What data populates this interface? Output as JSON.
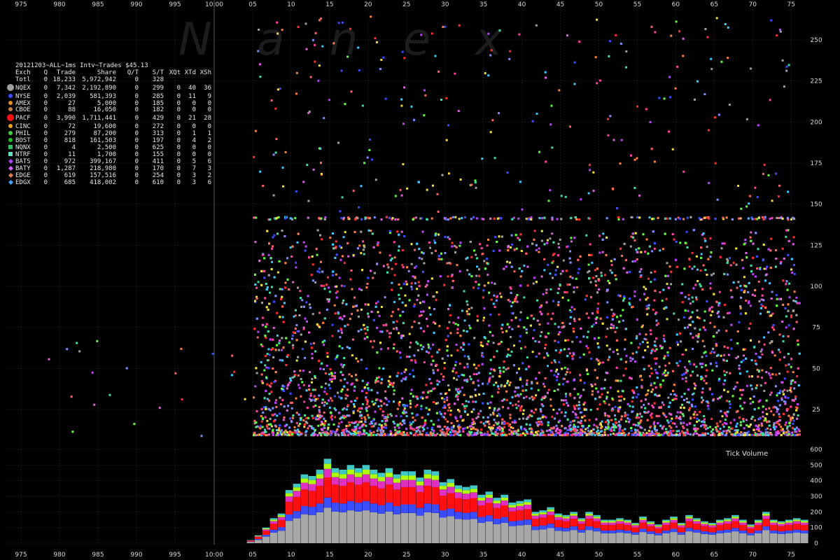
{
  "watermark": "N  a  n  e  x",
  "legend": {
    "title": "20121203~ALL~1ms Intv~Trades $45.13",
    "headers": [
      "Exch",
      "Q",
      "Trade",
      "Share",
      "Q/T",
      "S/T",
      "XQt",
      "XTd",
      "XSh"
    ],
    "rows": [
      {
        "exch": "Totl",
        "q": "0",
        "trade": "18,233",
        "share": "5,972,942",
        "qt": "0",
        "st": "328",
        "xqt": "",
        "xtd": "",
        "xsh": "",
        "color": "",
        "marker": "none"
      },
      {
        "exch": "NQEX",
        "q": "0",
        "trade": "7,342",
        "share": "2,192,890",
        "qt": "0",
        "st": "299",
        "xqt": "0",
        "xtd": "40",
        "xsh": "36",
        "color": "#a0a0a0",
        "marker": "big"
      },
      {
        "exch": "NYSE",
        "q": "0",
        "trade": "2,039",
        "share": "581,393",
        "qt": "0",
        "st": "285",
        "xqt": "0",
        "xtd": "11",
        "xsh": "9",
        "color": "#3a4dff",
        "marker": "dot"
      },
      {
        "exch": "AMEX",
        "q": "0",
        "trade": "27",
        "share": "5,000",
        "qt": "0",
        "st": "185",
        "xqt": "0",
        "xtd": "0",
        "xsh": "0",
        "color": "#e09020",
        "marker": "dot"
      },
      {
        "exch": "CBOE",
        "q": "0",
        "trade": "88",
        "share": "16,050",
        "qt": "0",
        "st": "182",
        "xqt": "0",
        "xtd": "0",
        "xsh": "0",
        "color": "#c08040",
        "marker": "dot"
      },
      {
        "exch": "PACF",
        "q": "0",
        "trade": "3,990",
        "share": "1,711,441",
        "qt": "0",
        "st": "429",
        "xqt": "0",
        "xtd": "21",
        "xsh": "28",
        "color": "#ff1010",
        "marker": "big"
      },
      {
        "exch": "CINC",
        "q": "0",
        "trade": "72",
        "share": "19,600",
        "qt": "0",
        "st": "272",
        "xqt": "0",
        "xtd": "0",
        "xsh": "0",
        "color": "#f0a020",
        "marker": "dot"
      },
      {
        "exch": "PHIL",
        "q": "0",
        "trade": "279",
        "share": "87,200",
        "qt": "0",
        "st": "313",
        "xqt": "0",
        "xtd": "1",
        "xsh": "1",
        "color": "#40d040",
        "marker": "dot"
      },
      {
        "exch": "BOST",
        "q": "0",
        "trade": "818",
        "share": "161,503",
        "qt": "0",
        "st": "197",
        "xqt": "0",
        "xtd": "4",
        "xsh": "2",
        "color": "#20c020",
        "marker": "dot"
      },
      {
        "exch": "NQNX",
        "q": "0",
        "trade": "4",
        "share": "2,500",
        "qt": "0",
        "st": "625",
        "xqt": "0",
        "xtd": "0",
        "xsh": "0",
        "color": "#30c060",
        "marker": "sq"
      },
      {
        "exch": "NTRF",
        "q": "0",
        "trade": "11",
        "share": "1,700",
        "qt": "0",
        "st": "155",
        "xqt": "0",
        "xtd": "0",
        "xsh": "0",
        "color": "#60e0c0",
        "marker": "sq"
      },
      {
        "exch": "BATS",
        "q": "0",
        "trade": "972",
        "share": "399,167",
        "qt": "0",
        "st": "411",
        "xqt": "0",
        "xtd": "5",
        "xsh": "6",
        "color": "#b040ff",
        "marker": "dia"
      },
      {
        "exch": "BATY",
        "q": "0",
        "trade": "1,287",
        "share": "218,980",
        "qt": "0",
        "st": "170",
        "xqt": "0",
        "xtd": "7",
        "xsh": "3",
        "color": "#d060ff",
        "marker": "dia"
      },
      {
        "exch": "EDGE",
        "q": "0",
        "trade": "619",
        "share": "157,516",
        "qt": "0",
        "st": "254",
        "xqt": "0",
        "xtd": "3",
        "xsh": "2",
        "color": "#e08040",
        "marker": "dia"
      },
      {
        "exch": "EDGX",
        "q": "0",
        "trade": "685",
        "share": "418,002",
        "qt": "0",
        "st": "610",
        "xqt": "0",
        "xtd": "3",
        "xsh": "6",
        "color": "#40a0ff",
        "marker": "dia"
      }
    ]
  },
  "chart_data": {
    "type": "scatter",
    "xlabel": "",
    "ylabel": "",
    "x_tick_labels": [
      "975",
      "980",
      "985",
      "990",
      "995",
      "10:00",
      "05",
      "10",
      "15",
      "20",
      "25",
      "30",
      "35",
      "40",
      "45",
      "50",
      "55",
      "60",
      "65",
      "70",
      "75"
    ],
    "trade_size_axis": {
      "ylim": [
        0,
        270
      ],
      "ticks": [
        25,
        50,
        75,
        100,
        125,
        150,
        175,
        200,
        225,
        250
      ]
    },
    "tick_volume": {
      "label": "Tick Volume",
      "ylim": [
        0,
        600
      ],
      "ticks": [
        0,
        100,
        200,
        300,
        400,
        500,
        600
      ],
      "series_order": [
        "NQEX",
        "NYSE",
        "PACF",
        "BATS",
        "BOST",
        "EDGX"
      ],
      "series_colors": [
        "#a8a8a8",
        "#3a4dff",
        "#ff1010",
        "#e030c0",
        "#b0ff00",
        "#40c8c8"
      ],
      "categories": [
        "03",
        "04",
        "05",
        "06",
        "07",
        "08",
        "09",
        "10",
        "11",
        "12",
        "13",
        "14",
        "15",
        "16",
        "17",
        "18",
        "19",
        "20",
        "21",
        "22",
        "23",
        "24",
        "25",
        "26",
        "27",
        "28",
        "29",
        "30",
        "31",
        "32",
        "33",
        "34",
        "35",
        "36",
        "37",
        "38",
        "39",
        "40",
        "41",
        "42",
        "43",
        "44",
        "45",
        "46",
        "47",
        "48",
        "49",
        "50",
        "51",
        "52",
        "53",
        "54",
        "55",
        "56",
        "57",
        "58",
        "59",
        "60",
        "61",
        "62",
        "63",
        "64",
        "65",
        "66",
        "67",
        "68",
        "69",
        "70",
        "71",
        "72",
        "73",
        "74",
        "75"
      ],
      "totals": [
        20,
        50,
        100,
        160,
        190,
        340,
        380,
        440,
        430,
        470,
        540,
        480,
        470,
        500,
        480,
        500,
        470,
        450,
        480,
        440,
        460,
        460,
        420,
        470,
        460,
        390,
        410,
        370,
        360,
        370,
        310,
        330,
        290,
        310,
        260,
        270,
        280,
        200,
        210,
        230,
        190,
        180,
        200,
        160,
        200,
        180,
        150,
        150,
        160,
        150,
        130,
        170,
        140,
        120,
        150,
        170,
        130,
        180,
        160,
        140,
        130,
        150,
        160,
        180,
        150,
        120,
        150,
        200,
        150,
        140,
        150,
        160,
        150
      ]
    },
    "scatter_region": {
      "x_start_label": "05",
      "x_end_label": "75",
      "y_range": [
        10,
        145
      ]
    }
  }
}
